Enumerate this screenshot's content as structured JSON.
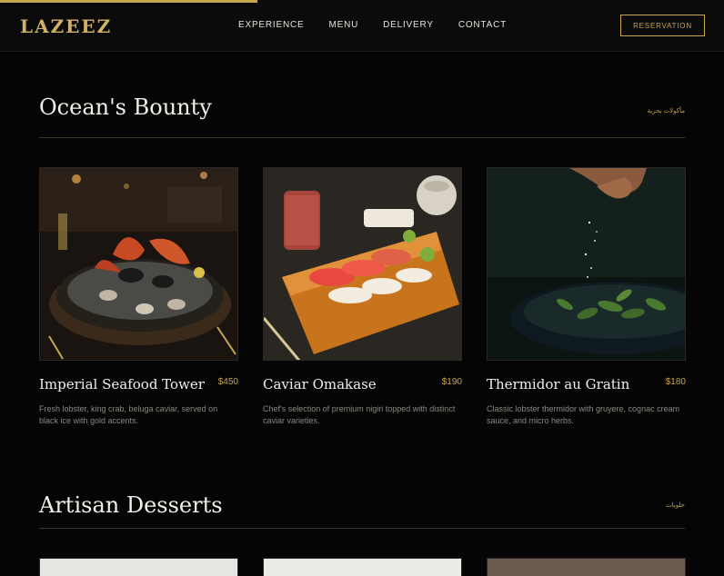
{
  "brand": {
    "logo": "LAZEEZ",
    "accent": "#c9a54e"
  },
  "header": {
    "scroll_progress": 0.355,
    "nav": [
      "EXPERIENCE",
      "MENU",
      "DELIVERY",
      "CONTACT"
    ],
    "reservation_label": "RESERVATION"
  },
  "sections": [
    {
      "title": "Ocean's Bounty",
      "arabic": "مأكولات بحرية",
      "items": [
        {
          "name": "Imperial Seafood Tower",
          "price": "$450",
          "description": "Fresh lobster, king crab, beluga caviar, served on black ice with gold accents.",
          "image": "seafood-tower-photo"
        },
        {
          "name": "Caviar Omakase",
          "price": "$190",
          "description": "Chef's selection of premium nigiri topped with distinct caviar varieties.",
          "image": "sushi-board-photo"
        },
        {
          "name": "Thermidor au Gratin",
          "price": "$180",
          "description": "Classic lobster thermidor with gruyere, cognac cream sauce, and micro herbs.",
          "image": "seasoning-bowl-photo"
        }
      ]
    },
    {
      "title": "Artisan Desserts",
      "arabic": "حلويات"
    }
  ]
}
